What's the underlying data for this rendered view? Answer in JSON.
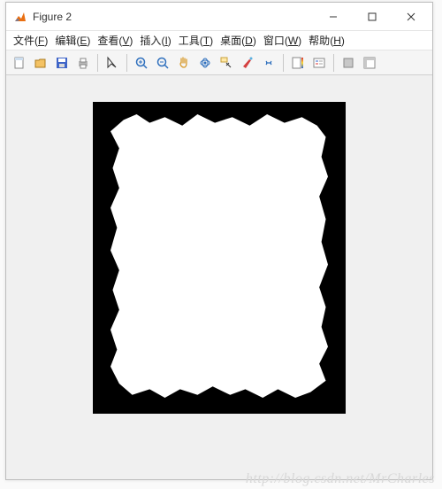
{
  "window": {
    "title": "Figure 2"
  },
  "menu": {
    "file": {
      "label": "文件",
      "accel": "F"
    },
    "edit": {
      "label": "编辑",
      "accel": "E"
    },
    "view": {
      "label": "查看",
      "accel": "V"
    },
    "insert": {
      "label": "插入",
      "accel": "I"
    },
    "tools": {
      "label": "工具",
      "accel": "T"
    },
    "desktop": {
      "label": "桌面",
      "accel": "D"
    },
    "winmenu": {
      "label": "窗口",
      "accel": "W"
    },
    "help": {
      "label": "帮助",
      "accel": "H"
    }
  },
  "toolbar_icons": {
    "new": "new-file-icon",
    "open": "open-folder-icon",
    "save": "save-icon",
    "print": "print-icon",
    "pointer": "pointer-icon",
    "zoom_in": "zoom-in-icon",
    "zoom_out": "zoom-out-icon",
    "pan": "pan-hand-icon",
    "rotate": "rotate-3d-icon",
    "data_cursor": "data-cursor-icon",
    "brush": "brush-icon",
    "link": "link-plots-icon",
    "colorbar": "insert-colorbar-icon",
    "legend": "insert-legend-icon",
    "hide_tools": "hide-plot-tools-icon",
    "show_tools": "show-plot-tools-icon"
  },
  "watermark": "http://blog.csdn.net/MrCharles"
}
